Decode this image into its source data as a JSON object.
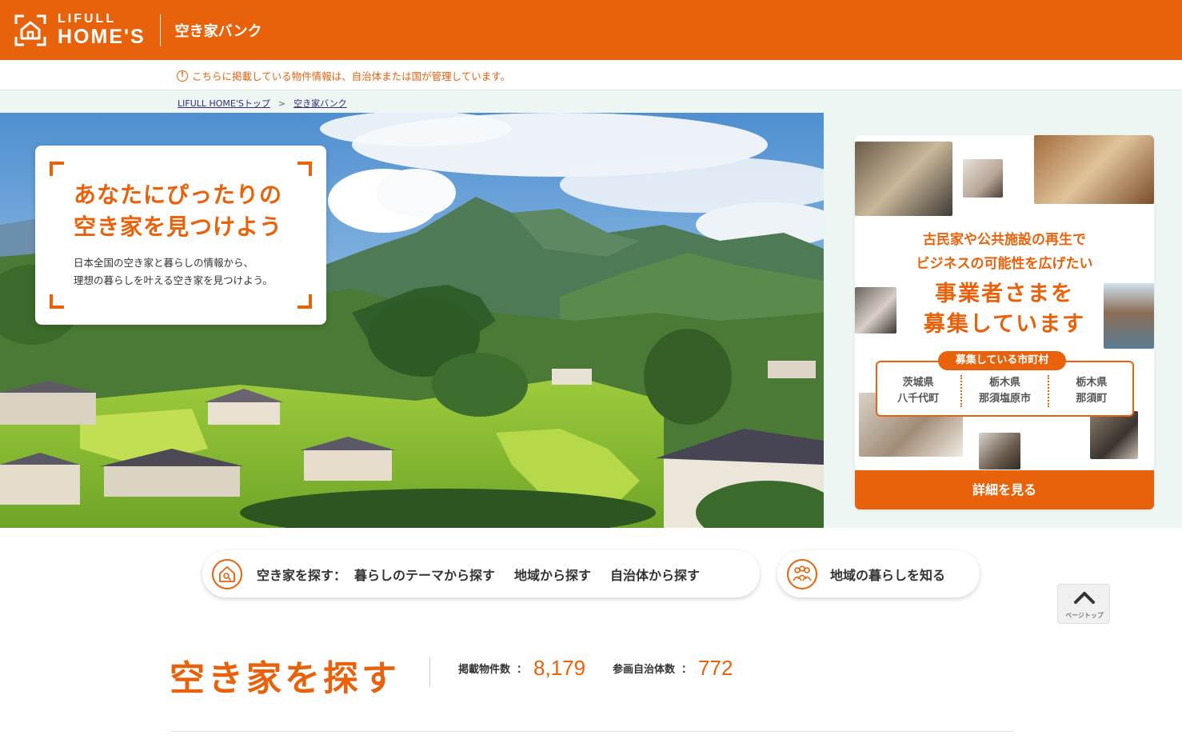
{
  "header": {
    "logo_small": "LIFULL",
    "logo_big": "HOME'S",
    "site_name": "空き家バンク"
  },
  "notice": {
    "icon": "!",
    "text": "こちらに掲載している物件情報は、自治体または国が管理しています。"
  },
  "breadcrumb": {
    "home": "LIFULL HOME'Sトップ",
    "separator": ">",
    "current": "空き家バンク"
  },
  "hero": {
    "headline_line1": "あなたにぴったりの",
    "headline_line2": "空き家を見つけよう",
    "sub_line1": "日本全国の空き家と暮らしの情報から、",
    "sub_line2": "理想の暮らしを叶える空き家を見つけよう。"
  },
  "banner": {
    "lead_line1": "古民家や公共施設の再生で",
    "lead_line2": "ビジネスの可能性を広げたい",
    "big_line1": "事業者さまを",
    "big_line2": "募集しています",
    "tag": "募集している市町村",
    "municipalities": [
      {
        "pref": "茨城県",
        "city": "八千代町"
      },
      {
        "pref": "栃木県",
        "city": "那須塩原市"
      },
      {
        "pref": "栃木県",
        "city": "那須町"
      }
    ],
    "button": "詳細を見る"
  },
  "nav": {
    "search_label": "空き家を探す：",
    "links": [
      "暮らしのテーマから探す",
      "地域から探す",
      "自治体から探す"
    ],
    "know_label": "地域の暮らしを知る"
  },
  "pagetop": {
    "label": "ページトップ"
  },
  "section": {
    "title": "空き家を探す",
    "stats": [
      {
        "label": "掲載物件数",
        "colon": "：",
        "value": "8,179"
      },
      {
        "label": "参画自治体数",
        "colon": "：",
        "value": "772"
      }
    ]
  },
  "colors": {
    "brand": "#e8620c",
    "hero_bg": "#eef6f4"
  }
}
